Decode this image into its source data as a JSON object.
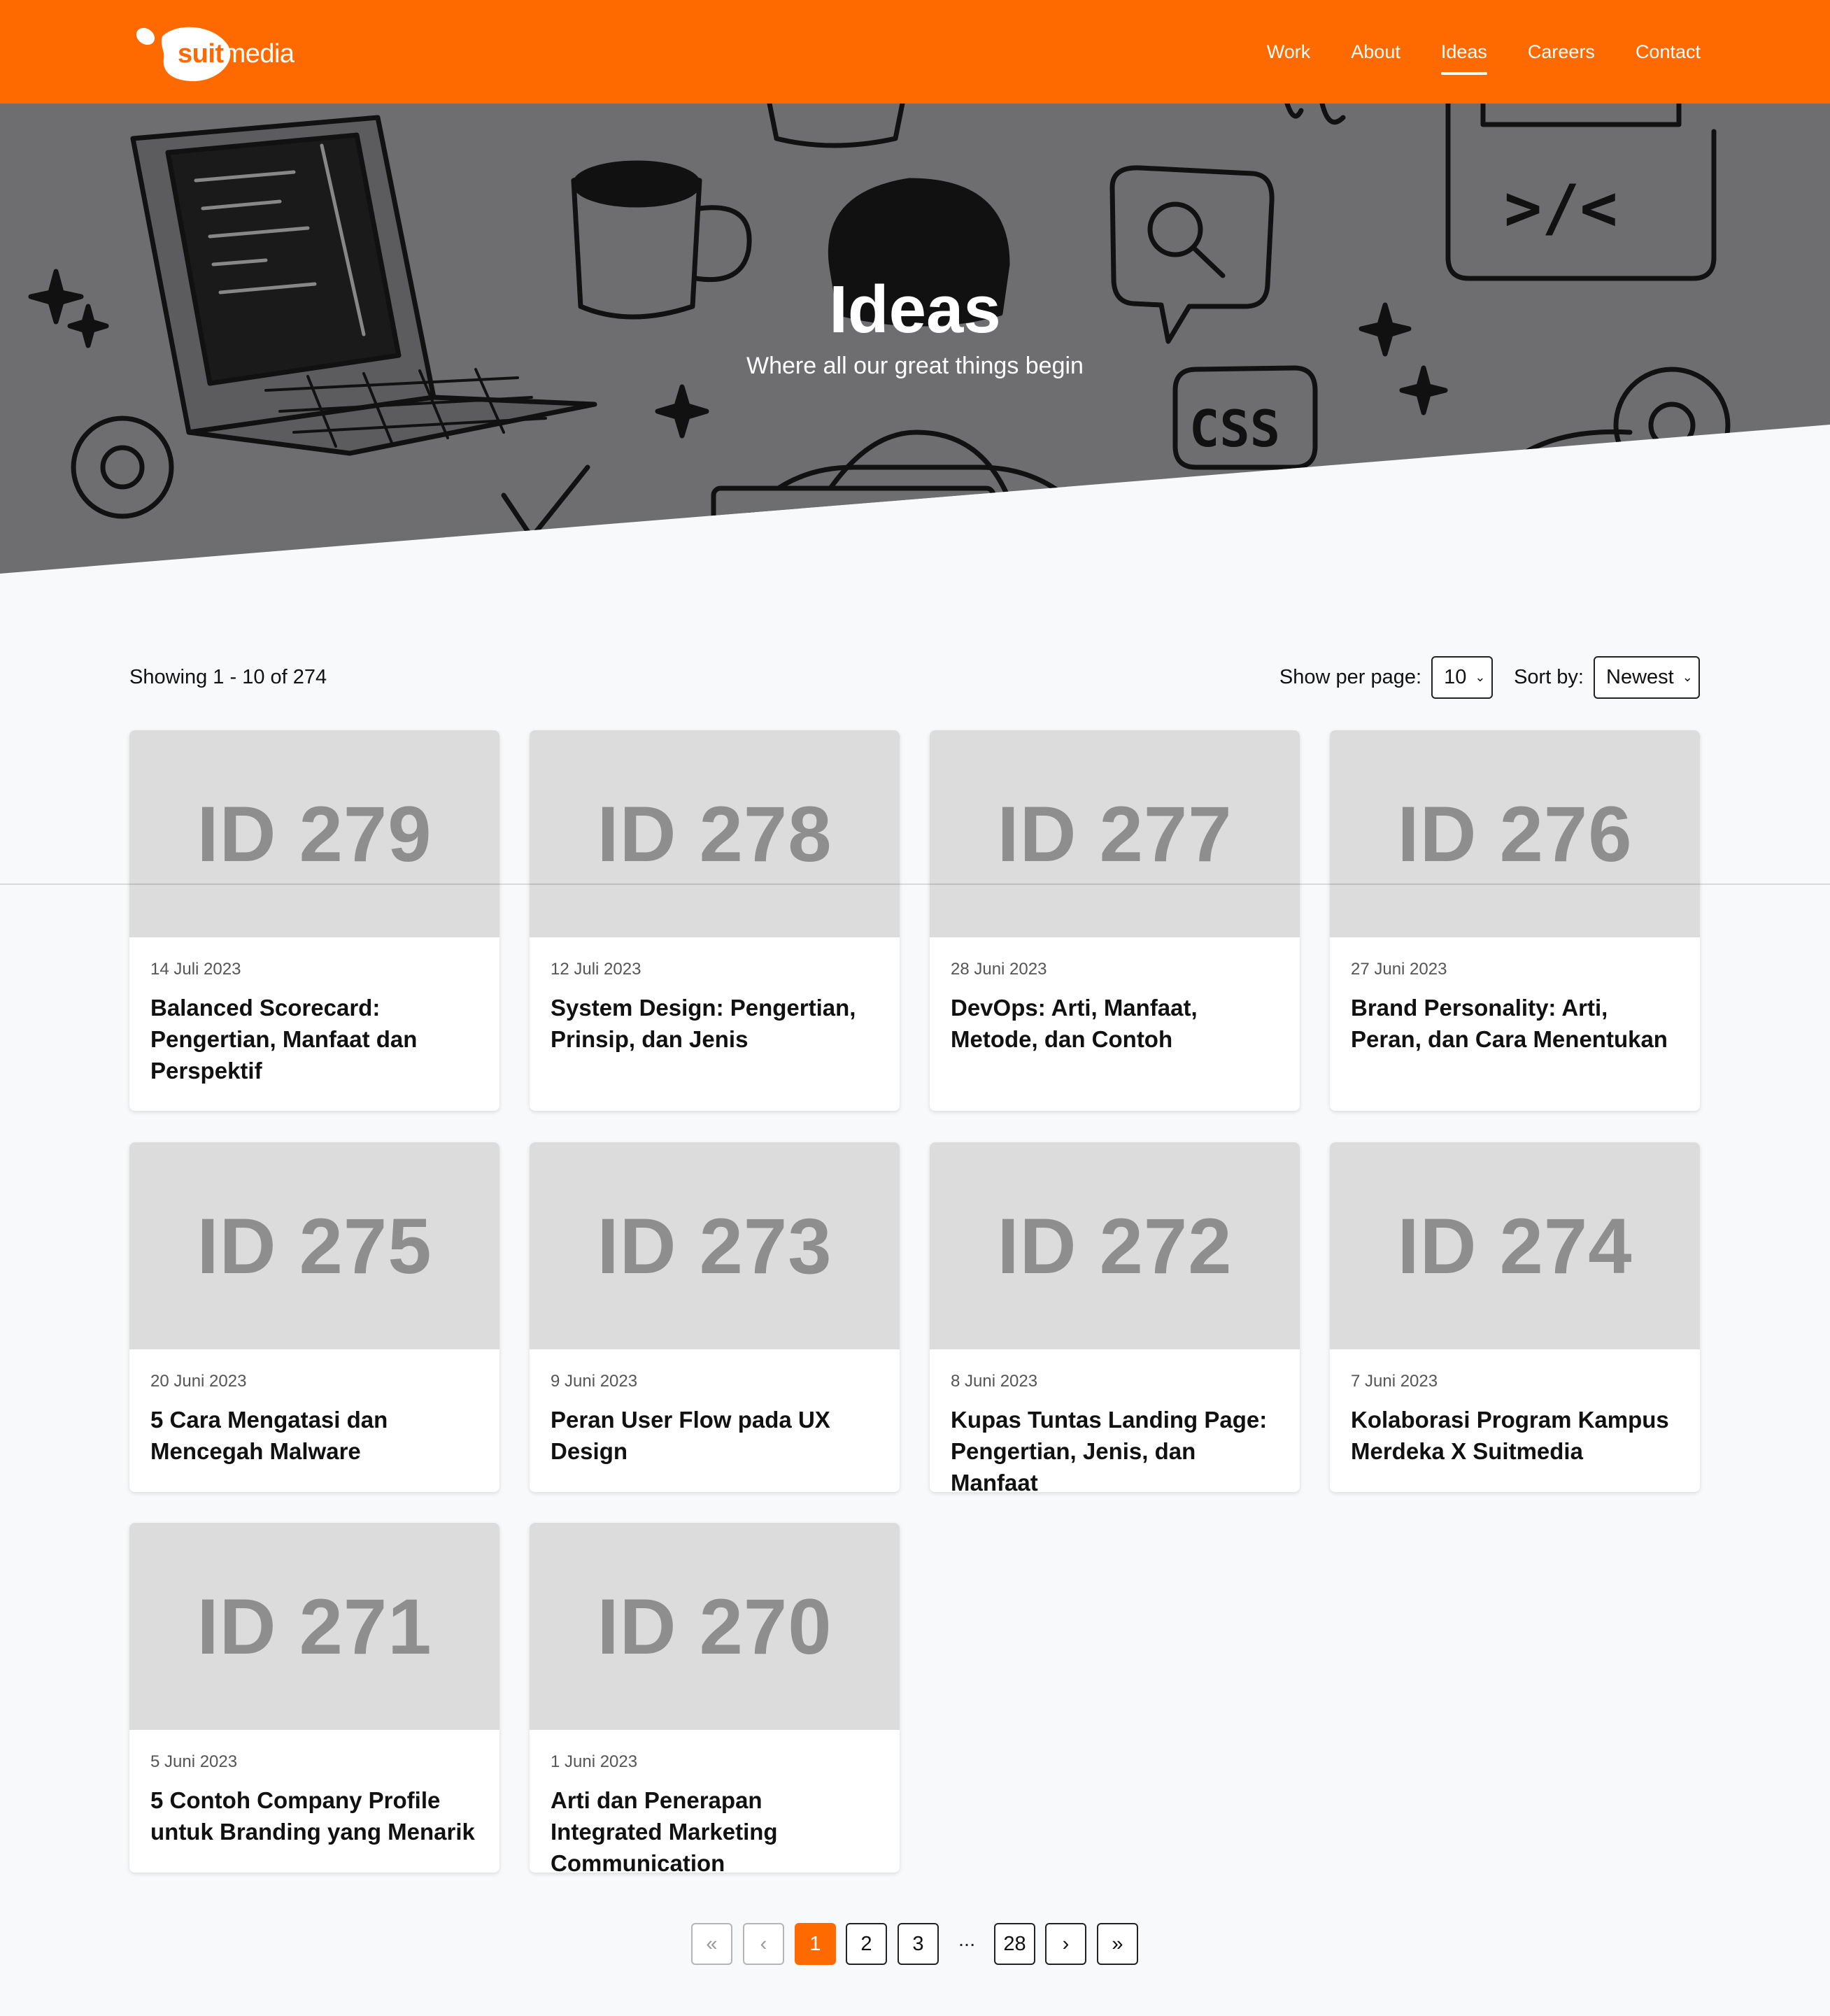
{
  "header": {
    "logo_word_bold": "suit",
    "logo_word_rest": "media",
    "nav": [
      {
        "label": "Work",
        "active": false
      },
      {
        "label": "About",
        "active": false
      },
      {
        "label": "Ideas",
        "active": true
      },
      {
        "label": "Careers",
        "active": false
      },
      {
        "label": "Contact",
        "active": false
      }
    ],
    "brand_color": "#ff6a00"
  },
  "hero": {
    "title": "Ideas",
    "subtitle": "Where all our great things begin",
    "doodle_text": {
      "code": ">/<",
      "css": "CSS"
    }
  },
  "listing": {
    "showing": "Showing 1 - 10 of 274",
    "per_page_label": "Show per page:",
    "per_page_value": "10",
    "sort_label": "Sort by:",
    "sort_value": "Newest"
  },
  "cards": [
    {
      "thumb": "ID 279",
      "date": "14 Juli 2023",
      "title": "Balanced Scorecard: Pengertian, Manfaat dan Perspektif"
    },
    {
      "thumb": "ID 278",
      "date": "12 Juli 2023",
      "title": "System Design: Pengertian, Prinsip, dan Jenis"
    },
    {
      "thumb": "ID 277",
      "date": "28 Juni 2023",
      "title": "DevOps: Arti, Manfaat, Metode, dan Contoh"
    },
    {
      "thumb": "ID 276",
      "date": "27 Juni 2023",
      "title": "Brand Personality: Arti, Peran, dan Cara Menentukan"
    },
    {
      "thumb": "ID 275",
      "date": "20 Juni 2023",
      "title": "5 Cara Mengatasi dan Mencegah Malware"
    },
    {
      "thumb": "ID 273",
      "date": "9 Juni 2023",
      "title": "Peran User Flow pada UX Design"
    },
    {
      "thumb": "ID 272",
      "date": "8 Juni 2023",
      "title": "Kupas Tuntas Landing Page: Pengertian, Jenis, dan Manfaat"
    },
    {
      "thumb": "ID 274",
      "date": "7 Juni 2023",
      "title": "Kolaborasi Program Kampus Merdeka X Suitmedia"
    },
    {
      "thumb": "ID 271",
      "date": "5 Juni 2023",
      "title": "5 Contoh Company Profile untuk Branding yang Menarik"
    },
    {
      "thumb": "ID 270",
      "date": "1 Juni 2023",
      "title": "Arti dan Penerapan Integrated Marketing Communication"
    }
  ],
  "pagination": {
    "first": "«",
    "prev": "‹",
    "pages": [
      "1",
      "2",
      "3"
    ],
    "current": "1",
    "ellipsis": "...",
    "last_page": "28",
    "next": "›",
    "last": "»"
  }
}
